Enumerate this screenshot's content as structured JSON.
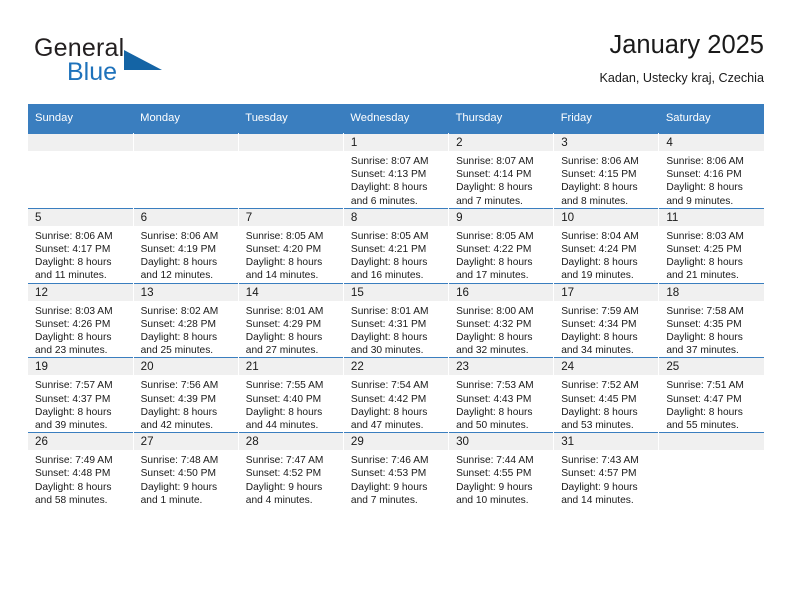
{
  "brand": {
    "name_part1": "General",
    "name_part2": "Blue",
    "triangle_icon": "triangle-icon",
    "accent_color": "#1464a5"
  },
  "header": {
    "title": "January 2025",
    "location": "Kadan, Ustecky kraj, Czechia"
  },
  "theme": {
    "header_bg": "#3a7ebf",
    "daynum_bg": "#f0f0f0",
    "text": "#1a1a1a"
  },
  "weekdays": [
    "Sunday",
    "Monday",
    "Tuesday",
    "Wednesday",
    "Thursday",
    "Friday",
    "Saturday"
  ],
  "weeks": [
    [
      {
        "day": "",
        "sunrise": "",
        "sunset": "",
        "daylight1": "",
        "daylight2": ""
      },
      {
        "day": "",
        "sunrise": "",
        "sunset": "",
        "daylight1": "",
        "daylight2": ""
      },
      {
        "day": "",
        "sunrise": "",
        "sunset": "",
        "daylight1": "",
        "daylight2": ""
      },
      {
        "day": "1",
        "sunrise": "Sunrise: 8:07 AM",
        "sunset": "Sunset: 4:13 PM",
        "daylight1": "Daylight: 8 hours",
        "daylight2": "and 6 minutes."
      },
      {
        "day": "2",
        "sunrise": "Sunrise: 8:07 AM",
        "sunset": "Sunset: 4:14 PM",
        "daylight1": "Daylight: 8 hours",
        "daylight2": "and 7 minutes."
      },
      {
        "day": "3",
        "sunrise": "Sunrise: 8:06 AM",
        "sunset": "Sunset: 4:15 PM",
        "daylight1": "Daylight: 8 hours",
        "daylight2": "and 8 minutes."
      },
      {
        "day": "4",
        "sunrise": "Sunrise: 8:06 AM",
        "sunset": "Sunset: 4:16 PM",
        "daylight1": "Daylight: 8 hours",
        "daylight2": "and 9 minutes."
      }
    ],
    [
      {
        "day": "5",
        "sunrise": "Sunrise: 8:06 AM",
        "sunset": "Sunset: 4:17 PM",
        "daylight1": "Daylight: 8 hours",
        "daylight2": "and 11 minutes."
      },
      {
        "day": "6",
        "sunrise": "Sunrise: 8:06 AM",
        "sunset": "Sunset: 4:19 PM",
        "daylight1": "Daylight: 8 hours",
        "daylight2": "and 12 minutes."
      },
      {
        "day": "7",
        "sunrise": "Sunrise: 8:05 AM",
        "sunset": "Sunset: 4:20 PM",
        "daylight1": "Daylight: 8 hours",
        "daylight2": "and 14 minutes."
      },
      {
        "day": "8",
        "sunrise": "Sunrise: 8:05 AM",
        "sunset": "Sunset: 4:21 PM",
        "daylight1": "Daylight: 8 hours",
        "daylight2": "and 16 minutes."
      },
      {
        "day": "9",
        "sunrise": "Sunrise: 8:05 AM",
        "sunset": "Sunset: 4:22 PM",
        "daylight1": "Daylight: 8 hours",
        "daylight2": "and 17 minutes."
      },
      {
        "day": "10",
        "sunrise": "Sunrise: 8:04 AM",
        "sunset": "Sunset: 4:24 PM",
        "daylight1": "Daylight: 8 hours",
        "daylight2": "and 19 minutes."
      },
      {
        "day": "11",
        "sunrise": "Sunrise: 8:03 AM",
        "sunset": "Sunset: 4:25 PM",
        "daylight1": "Daylight: 8 hours",
        "daylight2": "and 21 minutes."
      }
    ],
    [
      {
        "day": "12",
        "sunrise": "Sunrise: 8:03 AM",
        "sunset": "Sunset: 4:26 PM",
        "daylight1": "Daylight: 8 hours",
        "daylight2": "and 23 minutes."
      },
      {
        "day": "13",
        "sunrise": "Sunrise: 8:02 AM",
        "sunset": "Sunset: 4:28 PM",
        "daylight1": "Daylight: 8 hours",
        "daylight2": "and 25 minutes."
      },
      {
        "day": "14",
        "sunrise": "Sunrise: 8:01 AM",
        "sunset": "Sunset: 4:29 PM",
        "daylight1": "Daylight: 8 hours",
        "daylight2": "and 27 minutes."
      },
      {
        "day": "15",
        "sunrise": "Sunrise: 8:01 AM",
        "sunset": "Sunset: 4:31 PM",
        "daylight1": "Daylight: 8 hours",
        "daylight2": "and 30 minutes."
      },
      {
        "day": "16",
        "sunrise": "Sunrise: 8:00 AM",
        "sunset": "Sunset: 4:32 PM",
        "daylight1": "Daylight: 8 hours",
        "daylight2": "and 32 minutes."
      },
      {
        "day": "17",
        "sunrise": "Sunrise: 7:59 AM",
        "sunset": "Sunset: 4:34 PM",
        "daylight1": "Daylight: 8 hours",
        "daylight2": "and 34 minutes."
      },
      {
        "day": "18",
        "sunrise": "Sunrise: 7:58 AM",
        "sunset": "Sunset: 4:35 PM",
        "daylight1": "Daylight: 8 hours",
        "daylight2": "and 37 minutes."
      }
    ],
    [
      {
        "day": "19",
        "sunrise": "Sunrise: 7:57 AM",
        "sunset": "Sunset: 4:37 PM",
        "daylight1": "Daylight: 8 hours",
        "daylight2": "and 39 minutes."
      },
      {
        "day": "20",
        "sunrise": "Sunrise: 7:56 AM",
        "sunset": "Sunset: 4:39 PM",
        "daylight1": "Daylight: 8 hours",
        "daylight2": "and 42 minutes."
      },
      {
        "day": "21",
        "sunrise": "Sunrise: 7:55 AM",
        "sunset": "Sunset: 4:40 PM",
        "daylight1": "Daylight: 8 hours",
        "daylight2": "and 44 minutes."
      },
      {
        "day": "22",
        "sunrise": "Sunrise: 7:54 AM",
        "sunset": "Sunset: 4:42 PM",
        "daylight1": "Daylight: 8 hours",
        "daylight2": "and 47 minutes."
      },
      {
        "day": "23",
        "sunrise": "Sunrise: 7:53 AM",
        "sunset": "Sunset: 4:43 PM",
        "daylight1": "Daylight: 8 hours",
        "daylight2": "and 50 minutes."
      },
      {
        "day": "24",
        "sunrise": "Sunrise: 7:52 AM",
        "sunset": "Sunset: 4:45 PM",
        "daylight1": "Daylight: 8 hours",
        "daylight2": "and 53 minutes."
      },
      {
        "day": "25",
        "sunrise": "Sunrise: 7:51 AM",
        "sunset": "Sunset: 4:47 PM",
        "daylight1": "Daylight: 8 hours",
        "daylight2": "and 55 minutes."
      }
    ],
    [
      {
        "day": "26",
        "sunrise": "Sunrise: 7:49 AM",
        "sunset": "Sunset: 4:48 PM",
        "daylight1": "Daylight: 8 hours",
        "daylight2": "and 58 minutes."
      },
      {
        "day": "27",
        "sunrise": "Sunrise: 7:48 AM",
        "sunset": "Sunset: 4:50 PM",
        "daylight1": "Daylight: 9 hours",
        "daylight2": "and 1 minute."
      },
      {
        "day": "28",
        "sunrise": "Sunrise: 7:47 AM",
        "sunset": "Sunset: 4:52 PM",
        "daylight1": "Daylight: 9 hours",
        "daylight2": "and 4 minutes."
      },
      {
        "day": "29",
        "sunrise": "Sunrise: 7:46 AM",
        "sunset": "Sunset: 4:53 PM",
        "daylight1": "Daylight: 9 hours",
        "daylight2": "and 7 minutes."
      },
      {
        "day": "30",
        "sunrise": "Sunrise: 7:44 AM",
        "sunset": "Sunset: 4:55 PM",
        "daylight1": "Daylight: 9 hours",
        "daylight2": "and 10 minutes."
      },
      {
        "day": "31",
        "sunrise": "Sunrise: 7:43 AM",
        "sunset": "Sunset: 4:57 PM",
        "daylight1": "Daylight: 9 hours",
        "daylight2": "and 14 minutes."
      },
      {
        "day": "",
        "sunrise": "",
        "sunset": "",
        "daylight1": "",
        "daylight2": ""
      }
    ]
  ]
}
